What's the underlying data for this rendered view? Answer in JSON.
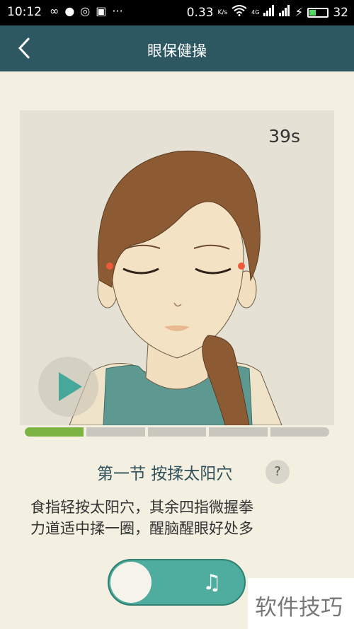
{
  "status": {
    "time": "10:12",
    "net_speed": "0.33",
    "net_unit": "K/s",
    "signal_tag": "4G",
    "battery": "32",
    "notification_icons": [
      "infinity-icon",
      "chat-icon",
      "weibo-icon",
      "app-icon",
      "more-icon"
    ]
  },
  "header": {
    "title": "眼保健操"
  },
  "player": {
    "timer": "39s",
    "progress": {
      "segments": 5,
      "completed": 1
    }
  },
  "section": {
    "title": "第一节 按揉太阳穴",
    "help_label": "?",
    "description_line1": "食指轻按太阳穴，其余四指微握拳",
    "description_line2": "力道适中揉一圈，醒脑醒眼好处多"
  },
  "music_toggle": {
    "icon": "music-note-icon",
    "label": "♫"
  },
  "watermark": "软件技巧",
  "colors": {
    "appbar": "#2d5862",
    "progress_done": "#7db342",
    "toggle": "#4ead9e",
    "background": "#f3f0e2"
  }
}
